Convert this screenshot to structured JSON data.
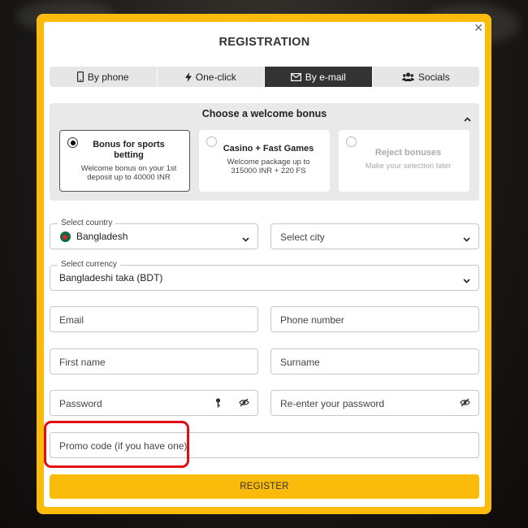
{
  "modal": {
    "title": "REGISTRATION",
    "close_icon": "close-icon"
  },
  "tabs": [
    {
      "label": "By phone",
      "icon": "phone-icon",
      "active": false
    },
    {
      "label": "One-click",
      "icon": "lightning-icon",
      "active": false
    },
    {
      "label": "By e-mail",
      "icon": "envelope-icon",
      "active": true
    },
    {
      "label": "Socials",
      "icon": "users-icon",
      "active": false
    }
  ],
  "bonus": {
    "heading": "Choose a welcome bonus",
    "options": [
      {
        "title": "Bonus for sports betting",
        "desc": "Welcome bonus on your 1st deposit up to 40000 INR",
        "selected": true
      },
      {
        "title": "Casino + Fast Games",
        "desc": "Welcome package up to 315000 INR + 220 FS",
        "selected": false
      },
      {
        "title": "Reject bonuses",
        "desc": "Make your selection later",
        "selected": false
      }
    ]
  },
  "form": {
    "country": {
      "label": "Select country",
      "value": "Bangladesh",
      "flag": "bangladesh-flag-icon"
    },
    "city": {
      "placeholder": "Select city"
    },
    "currency": {
      "label": "Select currency",
      "value": "Bangladeshi taka (BDT)"
    },
    "email": {
      "placeholder": "Email"
    },
    "phone": {
      "placeholder": "Phone number"
    },
    "first_name": {
      "placeholder": "First name"
    },
    "surname": {
      "placeholder": "Surname"
    },
    "password": {
      "placeholder": "Password"
    },
    "password_confirm": {
      "placeholder": "Re-enter your password"
    },
    "promo": {
      "placeholder": "Promo code (if you have one)"
    },
    "register_label": "REGISTER"
  },
  "colors": {
    "accent": "#fbbb0a",
    "active_tab": "#333333",
    "highlight": "#e20d12"
  }
}
